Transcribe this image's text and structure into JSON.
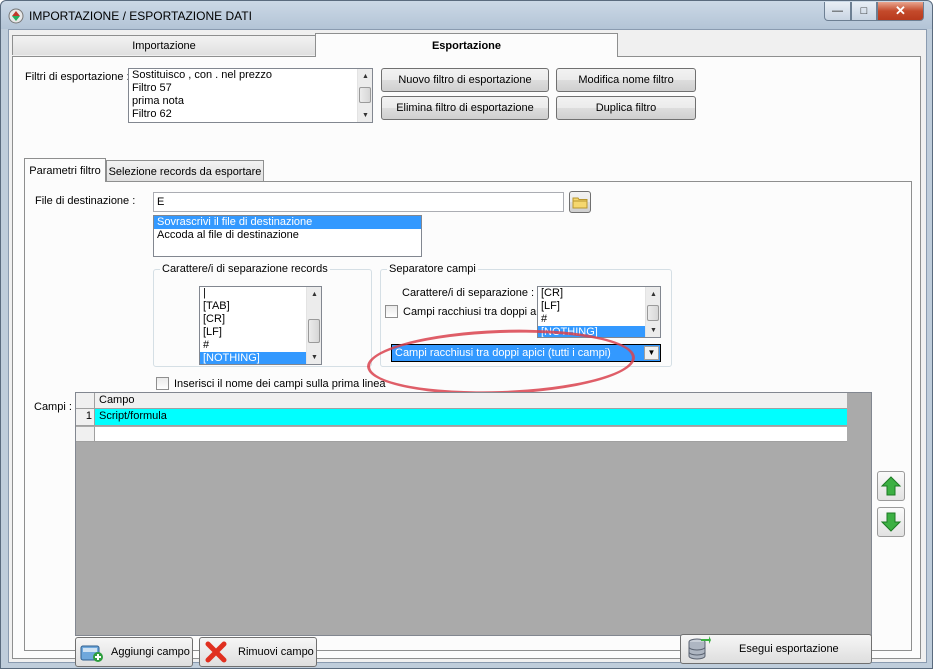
{
  "window": {
    "title": "IMPORTAZIONE / ESPORTAZIONE DATI"
  },
  "colors": {
    "selection": "#3399ff",
    "grid_row_highlight": "#00ffff",
    "grid_background": "#aaaaaa",
    "annotation_oval": "#d9424e"
  },
  "tabs": {
    "import_label": "Importazione",
    "export_label": "Esportazione"
  },
  "filters": {
    "label": "Filtri di esportazione :",
    "items": [
      "Sostituisco , con . nel prezzo",
      "Filtro 57",
      "prima nota",
      "Filtro 62"
    ],
    "new_button": "Nuovo filtro di esportazione",
    "rename_button": "Modifica nome filtro",
    "delete_button": "Elimina filtro di esportazione",
    "duplicate_button": "Duplica filtro"
  },
  "inner_tabs": {
    "params_label": "Parametri filtro",
    "records_label": "Selezione records da esportare"
  },
  "destination": {
    "label": "File di destinazione :",
    "value": "E",
    "mode_options": [
      "Sovrascrivi il file di destinazione",
      "Accoda al file di destinazione"
    ]
  },
  "record_separator": {
    "title": "Carattere/i di separazione records",
    "items": [
      "|",
      "[TAB]",
      "[CR]",
      "[LF]",
      "#",
      "[NOTHING]"
    ]
  },
  "field_separator": {
    "title": "Separatore campi",
    "chars_label": "Carattere/i di separazione :",
    "quote_checkbox_label": "Campi racchiusi tra doppi ap",
    "items": [
      "[CR]",
      "[LF]",
      "#",
      "[NOTHING]"
    ],
    "quote_mode": "Campi racchiusi tra doppi apici (tutti i campi)"
  },
  "header_checkbox_label": "Inserisci il nome dei campi sulla prima linea",
  "fields": {
    "label": "Campi :",
    "column_header": "Campo",
    "rows": [
      {
        "num": "1",
        "campo": "Script/formula"
      }
    ]
  },
  "buttons": {
    "add_field": "Aggiungi campo",
    "remove_field": "Rimuovi campo",
    "run_export": "Esegui esportazione"
  }
}
